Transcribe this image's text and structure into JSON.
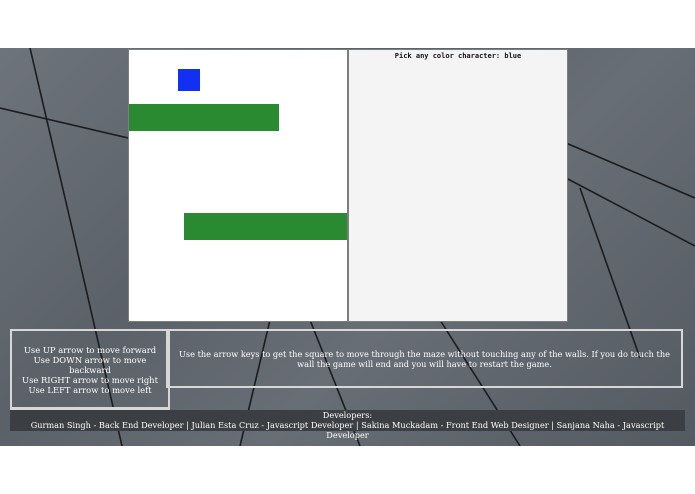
{
  "picker": {
    "label": "Pick any color character: blue"
  },
  "controls": {
    "lines": [
      "Use UP arrow to move forward",
      "Use DOWN arrow to move backward",
      "Use RIGHT arrow to move right",
      "Use LEFT arrow to move left"
    ]
  },
  "instructions": {
    "text": "Use the arrow keys to get the square to move through the maze without touching any of the walls. If you do touch the wall the game will end and you will have to restart the game."
  },
  "developers": {
    "heading": "Developers:",
    "list": "Gurman Singh - Back End Developer | Julian Esta Cruz - Javascript Developer | Sakina Muckadam - Front End Web Designer | Sanjana Naha - Javascript Developer"
  },
  "colors": {
    "player": "#1230f2",
    "wall": "#2a8a31",
    "background": "#5e646b"
  }
}
